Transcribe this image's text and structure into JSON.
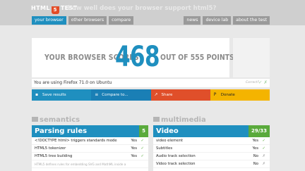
{
  "header": {
    "logo_left": "HTML",
    "logo_shield": "5",
    "logo_right": "TEST",
    "tagline": "how well does your browser support html5?"
  },
  "nav": {
    "left_tabs": [
      "your browser",
      "other browsers",
      "compare"
    ],
    "right_tabs": [
      "news",
      "device lab",
      "about the test"
    ]
  },
  "score": {
    "prefix": "YOUR BROWSER SCORES",
    "value": "468",
    "suffix": "OUT OF 555 POINTS"
  },
  "useragent": {
    "text": "You are using Firefox 71.0 on Ubuntu",
    "correct_label": "Correct?",
    "icons": "✓ ✗"
  },
  "actions": [
    {
      "label": "Save results",
      "icon": "save-icon"
    },
    {
      "label": "Compare to...",
      "icon": "compare-icon"
    },
    {
      "label": "Share",
      "icon": "share-icon"
    },
    {
      "label": "Donate",
      "icon": "donate-icon"
    }
  ],
  "sections": {
    "left": "semantics",
    "right": "multimedia"
  },
  "panels": {
    "left": {
      "title": "Parsing rules",
      "count": "5",
      "rows": [
        {
          "label": "<!DOCTYPE html> triggers standards mode",
          "value": "Yes"
        },
        {
          "label": "HTML5 tokenizer",
          "value": "Yes"
        },
        {
          "label": "HTML5 tree building",
          "value": "Yes"
        },
        {
          "label": "HTML5 defines rules for embedding SVG and MathML inside a",
          "value": ""
        }
      ]
    },
    "right": {
      "title": "Video",
      "count": "29/33",
      "rows": [
        {
          "label": "video element",
          "value": "Yes"
        },
        {
          "label": "Subtitles",
          "value": "Yes"
        },
        {
          "label": "Audio track selection",
          "value": "No"
        },
        {
          "label": "Video track selection",
          "value": "No"
        }
      ]
    }
  },
  "colors": {
    "accent": "#1f8fbf",
    "success": "#5aaa3c",
    "share": "#e04f2a",
    "donate": "#f4b400"
  }
}
